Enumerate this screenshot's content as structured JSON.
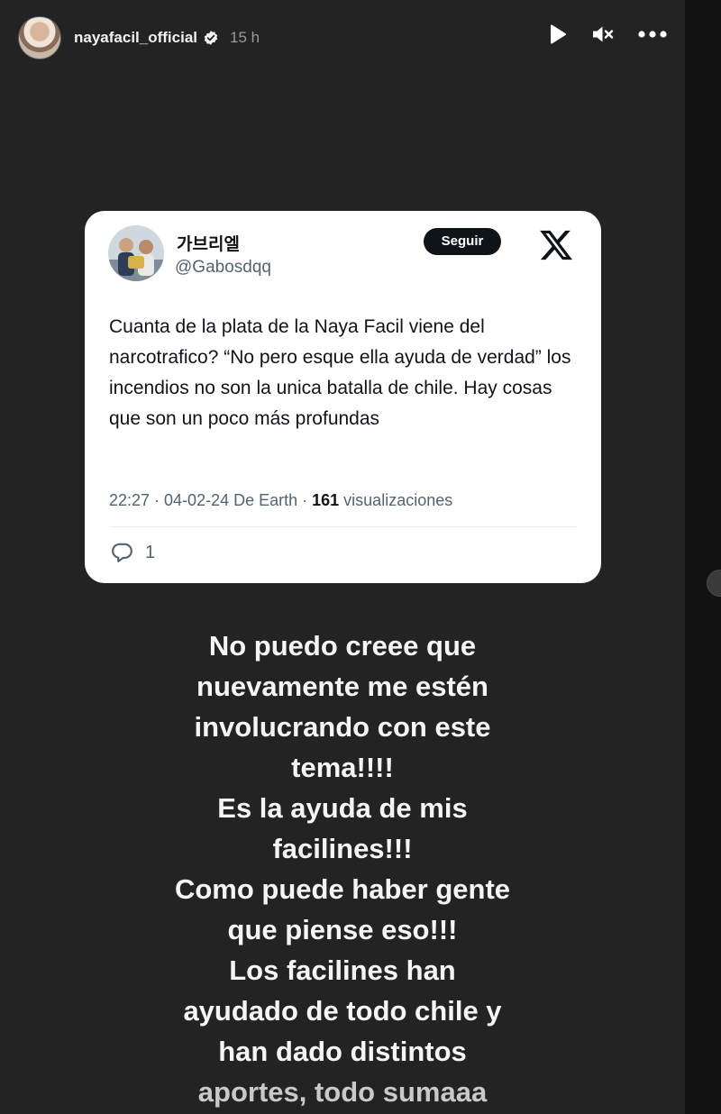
{
  "header": {
    "username": "nayafacil_official",
    "time": "15 h",
    "verified_icon": "verified-badge-icon",
    "play_icon": "play-icon",
    "mute_icon": "muted-speaker-icon",
    "more_icon": "more-horizontal-icon"
  },
  "tweet": {
    "display_name": "가브리엘",
    "handle": "@Gabosdqq",
    "follow_label": "Seguir",
    "logo_icon": "x-logo-icon",
    "body": "Cuanta de la plata de la Naya Facil viene del narcotrafico? “No pero esque ella ayuda de verdad” los incendios no son la unica batalla de chile. Hay cosas que son un poco más profundas",
    "meta_prefix": "22:27 · 04-02-24 De Earth · ",
    "views_count": "161",
    "views_label": " visualizaciones",
    "reply_icon": "reply-bubble-icon",
    "reply_count": "1"
  },
  "caption": {
    "lines": [
      "No puedo creee que",
      "nuevamente me estén",
      "involucrando con este",
      "tema!!!!",
      "Es la ayuda de mis",
      "facilines!!!",
      "Como puede haber gente",
      "que piense eso!!!",
      "Los facilines han",
      "ayudado de todo chile y",
      "han dado distintos",
      "aportes, todo sumaaa"
    ]
  },
  "colors": {
    "story_bg": "#232323",
    "card_bg": "#ffffff",
    "text_dark": "#0f1419",
    "text_muted": "#536471"
  }
}
